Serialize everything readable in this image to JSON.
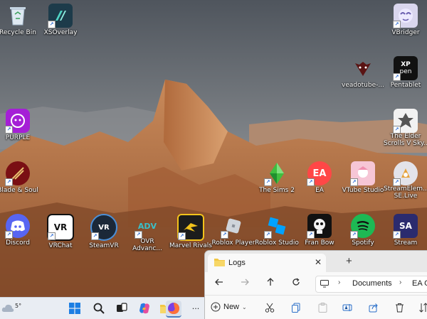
{
  "desktop": {
    "icons": [
      {
        "id": "recycle-bin",
        "label": "Recycle Bin"
      },
      {
        "id": "xsoverlay",
        "label": "XSOverlay"
      },
      {
        "id": "vbridger",
        "label": "VBridger"
      },
      {
        "id": "veadotube",
        "label": "veadotube-..."
      },
      {
        "id": "pentablet",
        "label": "Pentablet"
      },
      {
        "id": "purple",
        "label": "PURPLE"
      },
      {
        "id": "elder-scrolls",
        "label": "The Elder",
        "label2": "Scrolls V Sky..."
      },
      {
        "id": "blade-and-soul",
        "label": "Blade & Soul"
      },
      {
        "id": "sims2",
        "label": "The Sims 2"
      },
      {
        "id": "ea",
        "label": "EA"
      },
      {
        "id": "vtube-studio",
        "label": "VTube Studio"
      },
      {
        "id": "streamelements",
        "label": "StreamElem...",
        "label2": "SE.Live"
      },
      {
        "id": "discord",
        "label": "Discord"
      },
      {
        "id": "vrchat",
        "label": "VRChat"
      },
      {
        "id": "steamvr",
        "label": "SteamVR"
      },
      {
        "id": "ovr-advanced",
        "label": "OVR",
        "label2": "Advanc..."
      },
      {
        "id": "marvel-rivals",
        "label": "Marvel Rivals"
      },
      {
        "id": "roblox-player",
        "label": "Roblox Player"
      },
      {
        "id": "roblox-studio",
        "label": "Roblox Studio"
      },
      {
        "id": "fran-bow",
        "label": "Fran Bow"
      },
      {
        "id": "spotify",
        "label": "Spotify"
      },
      {
        "id": "stream",
        "label": "Stream"
      }
    ]
  },
  "tile_text": {
    "xp": "XP",
    "pen": "pen",
    "vr": "VR",
    "adv": "ADV",
    "ea": "EA",
    "sa": "SA"
  },
  "taskbar": {
    "weather_temp": "5°",
    "more": "···"
  },
  "explorer": {
    "tab_title": "Logs",
    "tab_close": "✕",
    "new_tab": "+",
    "breadcrumb": [
      "Documents",
      "EA G"
    ],
    "new_label": "New"
  }
}
